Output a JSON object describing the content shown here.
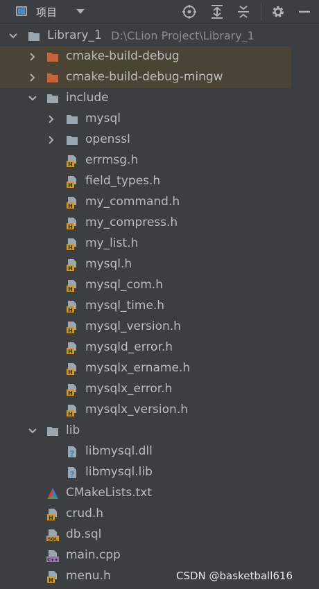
{
  "header": {
    "title": "项目",
    "icons": [
      "locate-icon",
      "expand-all-icon",
      "collapse-all-icon",
      "gear-icon",
      "minimize-icon"
    ]
  },
  "tree": {
    "root": {
      "label": "Library_1",
      "path": "D:\\CLion Project\\Library_1"
    },
    "items": [
      {
        "label": "cmake-build-debug"
      },
      {
        "label": "cmake-build-debug-mingw"
      },
      {
        "label": "include"
      },
      {
        "label": "mysql"
      },
      {
        "label": "openssl"
      },
      {
        "label": "errmsg.h"
      },
      {
        "label": "field_types.h"
      },
      {
        "label": "my_command.h"
      },
      {
        "label": "my_compress.h"
      },
      {
        "label": "my_list.h"
      },
      {
        "label": "mysql.h"
      },
      {
        "label": "mysql_com.h"
      },
      {
        "label": "mysql_time.h"
      },
      {
        "label": "mysql_version.h"
      },
      {
        "label": "mysqld_error.h"
      },
      {
        "label": "mysqlx_ername.h"
      },
      {
        "label": "mysqlx_error.h"
      },
      {
        "label": "mysqlx_version.h"
      },
      {
        "label": "lib"
      },
      {
        "label": "libmysql.dll"
      },
      {
        "label": "libmysql.lib"
      },
      {
        "label": "CMakeLists.txt"
      },
      {
        "label": "crud.h"
      },
      {
        "label": "db.sql"
      },
      {
        "label": "main.cpp"
      },
      {
        "label": "menu.h"
      }
    ],
    "badges": {
      "sql": "SQL",
      "cpp": "C++",
      "h": "H"
    }
  },
  "watermark": "CSDN @basketball616",
  "colors": {
    "background": "#3c3f41",
    "excluded_row": "#4a4436",
    "folder": "#9aa7b0",
    "excluded_folder": "#c5633b",
    "header_file": "#c79a36"
  }
}
